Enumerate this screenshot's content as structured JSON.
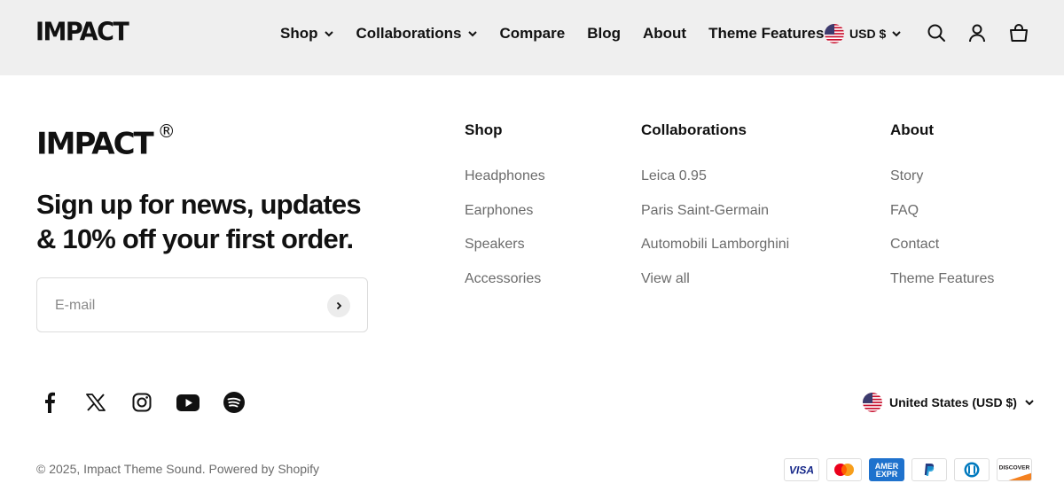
{
  "header": {
    "logo": "IMPACT",
    "nav": [
      {
        "label": "Shop",
        "has_dropdown": true
      },
      {
        "label": "Collaborations",
        "has_dropdown": true
      },
      {
        "label": "Compare",
        "has_dropdown": false
      },
      {
        "label": "Blog",
        "has_dropdown": false
      },
      {
        "label": "About",
        "has_dropdown": false
      },
      {
        "label": "Theme Features",
        "has_dropdown": false
      }
    ],
    "currency": "USD $",
    "icons": [
      "search-icon",
      "account-icon",
      "cart-icon"
    ]
  },
  "footer": {
    "logo": "IMPACT",
    "registered_mark": "®",
    "newsletter_heading": "Sign up for news, updates & 10% off your first order.",
    "email_placeholder": "E-mail",
    "columns": [
      {
        "title": "Shop",
        "links": [
          "Headphones",
          "Earphones",
          "Speakers",
          "Accessories"
        ]
      },
      {
        "title": "Collaborations",
        "links": [
          "Leica 0.95",
          "Paris Saint-Germain",
          "Automobili Lamborghini",
          "View all"
        ]
      },
      {
        "title": "About",
        "links": [
          "Story",
          "FAQ",
          "Contact",
          "Theme Features"
        ]
      }
    ],
    "socials": [
      "facebook-icon",
      "x-icon",
      "instagram-icon",
      "youtube-icon",
      "spotify-icon"
    ],
    "country_selector": "United States (USD $)",
    "copyright": "© 2025, Impact Theme Sound. Powered by Shopify",
    "payment_methods": [
      "Visa",
      "Mastercard",
      "American Express",
      "PayPal",
      "Diners Club",
      "Discover"
    ]
  },
  "colors": {
    "header_bg": "#efefef",
    "text": "#111111",
    "muted": "#6b6b6b",
    "border": "#dcdcdc"
  }
}
